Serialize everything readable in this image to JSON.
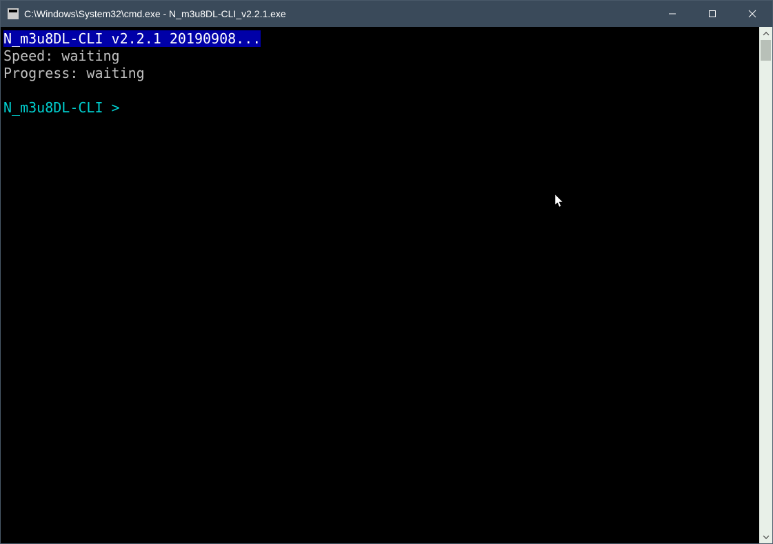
{
  "titlebar": {
    "title": "C:\\Windows\\System32\\cmd.exe - N_m3u8DL-CLI_v2.2.1.exe"
  },
  "terminal": {
    "header": "N_m3u8DL-CLI v2.2.1 20190908...",
    "speed_line": "Speed: waiting",
    "progress_line": "Progress: waiting",
    "prompt": "N_m3u8DL-CLI > "
  }
}
